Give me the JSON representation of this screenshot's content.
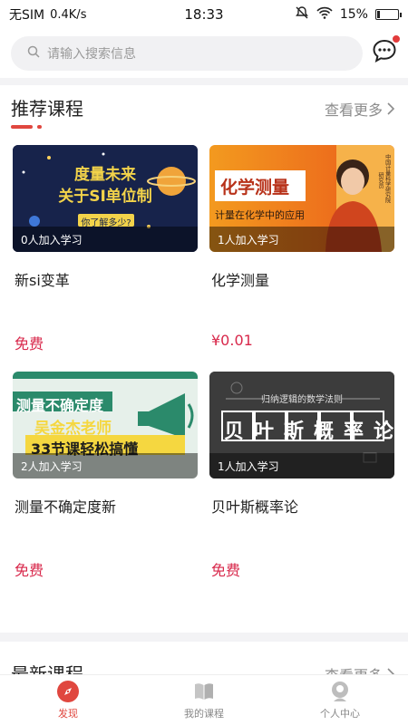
{
  "status": {
    "carrier": "无SIM",
    "speed": "0.4K/s",
    "time": "18:33",
    "battery": "15%",
    "battery_level": 0.15
  },
  "search": {
    "placeholder": "请输入搜索信息"
  },
  "recommended": {
    "title": "推荐课程",
    "more": "查看更多",
    "courses": [
      {
        "name": "新si变革",
        "enrolled": "0人加入学习",
        "price": "免费",
        "thumb_text": [
          "度量未来",
          "关于SI单位制",
          "你了解多少?"
        ]
      },
      {
        "name": "化学测量",
        "enrolled": "1人加入学习",
        "price": "¥0.01",
        "thumb_text": [
          "化学测量",
          "计量在化学中的应用",
          "中国计量科学研究院",
          "研究员"
        ]
      },
      {
        "name": "测量不确定度新",
        "enrolled": "2人加入学习",
        "price": "免费",
        "thumb_text": [
          "测量不确定度",
          "吴金杰老师",
          "33节课轻松搞懂"
        ]
      },
      {
        "name": "贝叶斯概率论",
        "enrolled": "1人加入学习",
        "price": "免费",
        "thumb_text": [
          "归纳逻辑的数学法则",
          "贝叶斯概率论"
        ]
      }
    ]
  },
  "latest": {
    "title": "最新课程",
    "more": "查看更多"
  },
  "nav": [
    {
      "label": "发现",
      "icon": "compass-icon",
      "active": true
    },
    {
      "label": "我的课程",
      "icon": "book-icon",
      "active": false
    },
    {
      "label": "个人中心",
      "icon": "person-icon",
      "active": false
    }
  ],
  "colors": {
    "accent": "#e0473f",
    "price": "#d8284b"
  }
}
